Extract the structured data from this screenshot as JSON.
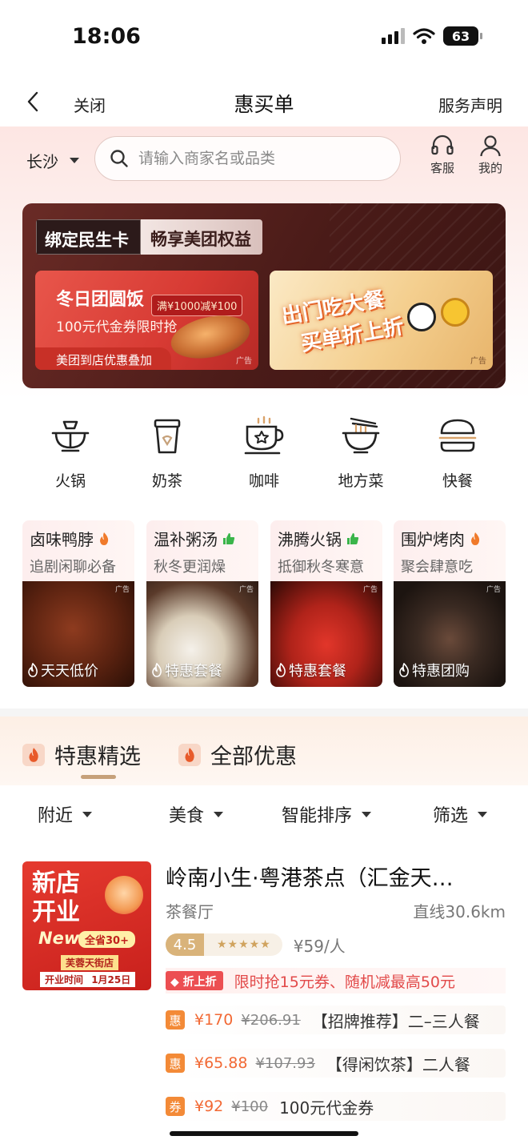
{
  "status_bar": {
    "time": "18:06",
    "battery": "63"
  },
  "nav": {
    "close": "关闭",
    "title": "惠买单",
    "service": "服务声明"
  },
  "header": {
    "city": "长沙",
    "search_placeholder": "请输入商家名或品类",
    "support": "客服",
    "mine": "我的"
  },
  "banner": {
    "tag_left": "绑定民生卡",
    "tag_right": "畅享美团权益",
    "promo1": {
      "title": "冬日团圆饭",
      "badge": "满¥1000减¥100",
      "subtitle": "100元代金券限时抢",
      "footer": "美团到店优惠叠加",
      "ad": "广告"
    },
    "promo2": {
      "line1": "出门吃大餐",
      "line2": "买单折上折",
      "ad": "广告"
    }
  },
  "categories": [
    {
      "label": "火锅",
      "icon": "hotpot-icon"
    },
    {
      "label": "奶茶",
      "icon": "milk-tea-icon"
    },
    {
      "label": "咖啡",
      "icon": "coffee-icon"
    },
    {
      "label": "地方菜",
      "icon": "noodle-bowl-icon"
    },
    {
      "label": "快餐",
      "icon": "burger-icon"
    }
  ],
  "featured": [
    {
      "title": "卤味鸭脖",
      "subtitle": "追剧闲聊必备",
      "badge_icon": "flame-icon",
      "label": "天天低价",
      "ad": "广告"
    },
    {
      "title": "温补粥汤",
      "subtitle": "秋冬更润燥",
      "badge_icon": "thumb-up-icon",
      "label": "特惠套餐",
      "ad": "广告"
    },
    {
      "title": "沸腾火锅",
      "subtitle": "抵御秋冬寒意",
      "badge_icon": "thumb-up-icon",
      "label": "特惠套餐",
      "ad": "广告"
    },
    {
      "title": "围炉烤肉",
      "subtitle": "聚会肆意吃",
      "badge_icon": "flame-icon",
      "label": "特惠团购",
      "ad": "广告"
    }
  ],
  "tabs": [
    {
      "label": "特惠精选",
      "active": true
    },
    {
      "label": "全部优惠",
      "active": false
    }
  ],
  "filters": [
    "附近",
    "美食",
    "智能排序",
    "筛选"
  ],
  "shop": {
    "image_text": {
      "line1": "新店",
      "line2": "开业",
      "new": "New",
      "pill": "全省30+",
      "location": "芙蓉天街店",
      "open_label": "开业时间",
      "open_date": "1月25日"
    },
    "name": "岭南小生·粤港茶点（汇金天…",
    "category": "茶餐厅",
    "distance": "直线30.6km",
    "rating": "4.5",
    "stars": "★★★★★",
    "price_per_person": "¥59/人",
    "deal_tag": "折上折",
    "deal_text": "限时抢15元券、随机减最高50元",
    "offers": [
      {
        "badge": "惠",
        "price": "¥170",
        "original": "¥206.91",
        "name": "【招牌推荐】二–三人餐"
      },
      {
        "badge": "惠",
        "price": "¥65.88",
        "original": "¥107.93",
        "name": "【得闲饮茶】二人餐"
      },
      {
        "badge": "券",
        "price": "¥92",
        "original": "¥100",
        "name": "100元代金券"
      }
    ]
  },
  "colors": {
    "accent_red": "#e24a4a",
    "offer_orange": "#f38a37",
    "gold": "#d9b37a",
    "banner_brown": "#4a1b18"
  }
}
